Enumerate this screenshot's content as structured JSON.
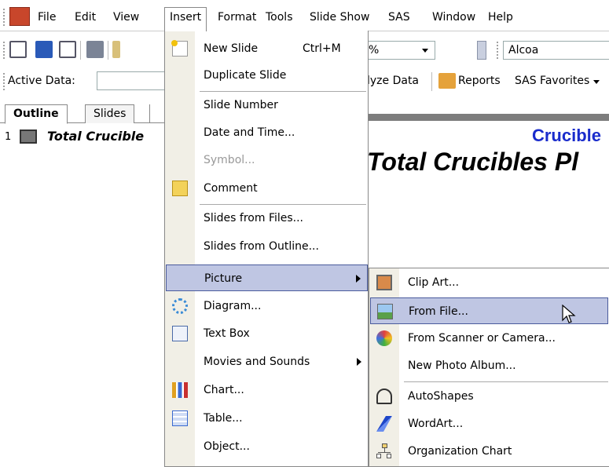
{
  "menubar": {
    "items": [
      "File",
      "Edit",
      "View",
      "Insert",
      "Format",
      "Tools",
      "Slide Show",
      "SAS",
      "Window",
      "Help"
    ]
  },
  "toolbar": {
    "zoom_value": "%",
    "font_name": "Alcoa",
    "active_data_label": "Active Data:",
    "analyze_data_label": "lyze Data",
    "reports_label": "Reports",
    "sas_favorites_label": "SAS Favorites"
  },
  "left_panel": {
    "tabs": [
      "Outline",
      "Slides"
    ],
    "slide_number": "1",
    "slide_title": "Total Crucible"
  },
  "slide": {
    "title_line1": "Crucible",
    "title_line2": "Total Crucibles Pl"
  },
  "insert_menu": {
    "items": [
      {
        "label": "New Slide",
        "shortcut": "Ctrl+M",
        "icon": "new-slide-icon"
      },
      {
        "label": "Duplicate Slide"
      },
      {
        "label": "Slide Number"
      },
      {
        "label": "Date and Time..."
      },
      {
        "label": "Symbol...",
        "disabled": true
      },
      {
        "label": "Comment",
        "icon": "comment-icon"
      },
      {
        "label": "Slides from Files..."
      },
      {
        "label": "Slides from Outline..."
      },
      {
        "label": "Picture",
        "submenu": true,
        "highlighted": true
      },
      {
        "label": "Diagram...",
        "icon": "diagram-icon"
      },
      {
        "label": "Text Box",
        "icon": "text-box-icon"
      },
      {
        "label": "Movies and Sounds",
        "submenu": true
      },
      {
        "label": "Chart...",
        "icon": "chart-icon"
      },
      {
        "label": "Table...",
        "icon": "table-icon"
      },
      {
        "label": "Object..."
      }
    ]
  },
  "picture_menu": {
    "items": [
      {
        "label": "Clip Art...",
        "icon": "clip-art-icon"
      },
      {
        "label": "From File...",
        "icon": "from-file-icon",
        "highlighted": true
      },
      {
        "label": "From Scanner or Camera...",
        "icon": "scanner-icon"
      },
      {
        "label": "New Photo Album..."
      },
      {
        "label": "AutoShapes",
        "icon": "autoshapes-icon"
      },
      {
        "label": "WordArt...",
        "icon": "wordart-icon"
      },
      {
        "label": "Organization Chart",
        "icon": "org-chart-icon"
      }
    ]
  },
  "colors": {
    "highlight": "#bfc6e3",
    "highlight_border": "#4a5b9c",
    "menu_gutter": "#f1efe6",
    "slide_title_blue": "#1a2ccc"
  }
}
